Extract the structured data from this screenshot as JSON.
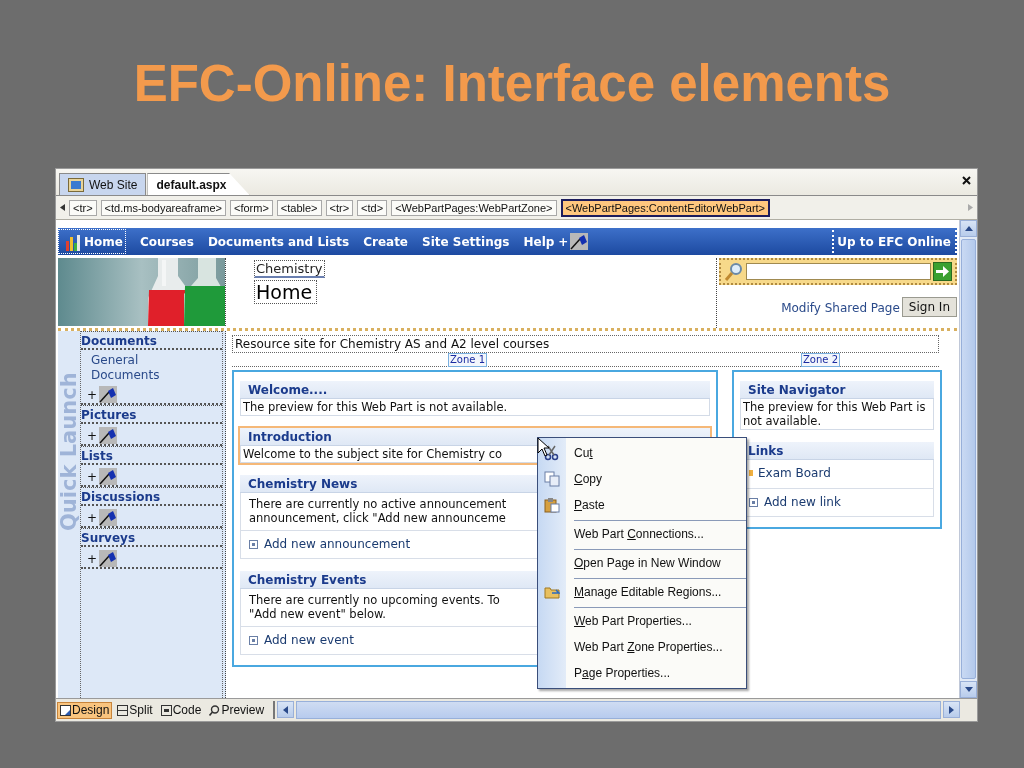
{
  "slide_title": "EFC-Online: Interface elements",
  "document_tabs": [
    {
      "label": "Web Site",
      "selected": false
    },
    {
      "label": "default.aspx",
      "selected": true
    }
  ],
  "tag_path": [
    {
      "label": "<tr>",
      "selected": false
    },
    {
      "label": "<td.ms-bodyareaframe>",
      "selected": false
    },
    {
      "label": "<form>",
      "selected": false
    },
    {
      "label": "<table>",
      "selected": false
    },
    {
      "label": "<tr>",
      "selected": false
    },
    {
      "label": "<td>",
      "selected": false
    },
    {
      "label": "<WebPartPages:WebPartZone>",
      "selected": false
    },
    {
      "label": "<WebPartPages:ContentEditorWebPart>",
      "selected": true
    }
  ],
  "nav_bar": {
    "items": [
      "Home",
      "Courses",
      "Documents and Lists",
      "Create",
      "Site Settings",
      "Help"
    ],
    "add": "+",
    "right_link": "Up to EFC Online"
  },
  "header": {
    "site_title": "Chemistry",
    "page_title": "Home",
    "modify_link": "Modify Shared Page",
    "sign_in": "Sign In"
  },
  "quick_launch": {
    "watermark": "Quick Launch",
    "sections": [
      {
        "title": "Documents",
        "items": [
          "General Documents"
        ],
        "add": "+"
      },
      {
        "title": "Pictures",
        "add": "+"
      },
      {
        "title": "Lists",
        "add": "+"
      },
      {
        "title": "Discussions",
        "add": "+"
      },
      {
        "title": "Surveys",
        "add": "+"
      }
    ]
  },
  "description": "Resource site for Chemistry AS and A2 level courses",
  "zones": [
    {
      "label": "Zone 1",
      "web_parts": [
        {
          "title": "Welcome....",
          "kind": "preview",
          "selected": false,
          "text": "The preview for this Web Part is not available."
        },
        {
          "title": "Introduction",
          "kind": "preview",
          "selected": true,
          "text": "Welcome to the subject site for Chemistry co"
        },
        {
          "title": "Chemistry News",
          "kind": "list",
          "selected": false,
          "lines": [
            "There are currently no active announcement",
            "announcement, click \"Add new announceme"
          ],
          "add_link": "Add new announcement"
        },
        {
          "title": "Chemistry Events",
          "kind": "list",
          "selected": false,
          "lines": [
            "There are currently no upcoming events. To",
            "\"Add new event\" below."
          ],
          "add_link": "Add new event"
        }
      ]
    },
    {
      "label": "Zone 2",
      "web_parts": [
        {
          "title": "Site Navigator",
          "kind": "preview",
          "selected": false,
          "text": "The preview for this Web Part is not available."
        },
        {
          "title": "Links",
          "kind": "links",
          "selected": false,
          "items": [
            "Exam Board"
          ],
          "add_link": "Add new link"
        }
      ]
    }
  ],
  "context_menu": [
    {
      "before": "Cu",
      "key": "t",
      "kind": "cut",
      "separator_before": false
    },
    {
      "key": "C",
      "after": "opy",
      "kind": "copy",
      "separator_before": false
    },
    {
      "key": "P",
      "after": "aste",
      "kind": "paste",
      "separator_before": false
    },
    {
      "before": "Web Part ",
      "key": "C",
      "after": "onnections...",
      "kind": "plain",
      "separator_before": true
    },
    {
      "key": "O",
      "after": "pen Page in New Window",
      "kind": "plain",
      "separator_before": true
    },
    {
      "key": "M",
      "after": "anage Editable Regions...",
      "kind": "manage",
      "separator_before": true
    },
    {
      "key": "W",
      "after": "eb Part Properties...",
      "kind": "plain",
      "separator_before": true
    },
    {
      "before": "Web Part ",
      "key": "Z",
      "after": "one Properties...",
      "kind": "plain",
      "separator_before": false
    },
    {
      "before": "P",
      "key": "a",
      "after": "ge Properties...",
      "kind": "plain",
      "separator_before": false
    }
  ],
  "view_tabs": [
    {
      "label": "Design",
      "selected": true
    },
    {
      "label": "Split",
      "selected": false
    },
    {
      "label": "Code",
      "selected": false
    },
    {
      "label": "Preview",
      "selected": false
    }
  ]
}
